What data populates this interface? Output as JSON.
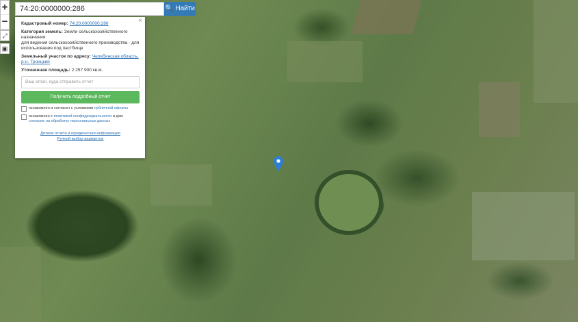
{
  "search": {
    "value": "74:20:0000000:286",
    "button_label": "Найти"
  },
  "map_controls": {
    "zoom_in": "+",
    "zoom_out": "−"
  },
  "panel": {
    "close_label": "×",
    "cadastral_label": "Кадастровый номер:",
    "cadastral_value": "74:20:0000000:286",
    "category_label": "Категория земель:",
    "category_value": "Земли сельскохозяйственного назначения",
    "usage_value": "для ведения сельскохозяйственного производства - для использования под пастбище",
    "address_label": "Земельный участок по адресу:",
    "address_value": "Челябинская область, р-н. Троицкий",
    "area_label": "Уточненная площадь:",
    "area_value": "2 257 900 кв.м.",
    "email_placeholder": "Ваш email, куда отправить отчет",
    "report_button": "Получить подробный отчет",
    "consent1_text": "ознакомлен и согласен с условиями",
    "consent1_link": "публичной оферты",
    "consent2_text": "ознакомлен с",
    "consent2_link1": "политикой конфиденциальности",
    "consent2_mid": "и даю",
    "consent2_link2": "согласие на обработку персональных данных",
    "link_details": "Детали отчета и юридическая информация",
    "link_manual": "Ручной выбор вариантов"
  },
  "colors": {
    "accent": "#337ab7",
    "report_button": "#5cb85c",
    "link": "#2a6fb0",
    "marker": "#2f7fd0"
  },
  "icons": {
    "search": "search-icon",
    "marker": "map-pin-icon",
    "ruler": "ruler-icon",
    "print": "print-icon"
  }
}
